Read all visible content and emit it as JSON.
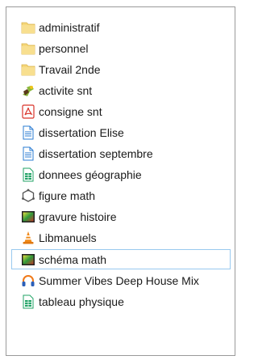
{
  "files": [
    {
      "name": "administratif",
      "icon": "folder-icon",
      "selected": false
    },
    {
      "name": "personnel",
      "icon": "folder-icon",
      "selected": false
    },
    {
      "name": "Travail 2nde",
      "icon": "folder-icon",
      "selected": false
    },
    {
      "name": "activite snt",
      "icon": "application-icon",
      "selected": false
    },
    {
      "name": "consigne snt",
      "icon": "pdf-icon",
      "selected": false
    },
    {
      "name": "dissertation Elise",
      "icon": "document-icon",
      "selected": false
    },
    {
      "name": "dissertation septembre",
      "icon": "document-icon",
      "selected": false
    },
    {
      "name": "donnees géographie",
      "icon": "spreadsheet-icon",
      "selected": false
    },
    {
      "name": "figure math",
      "icon": "geometry-icon",
      "selected": false
    },
    {
      "name": "gravure histoire",
      "icon": "image-icon",
      "selected": false
    },
    {
      "name": "Libmanuels",
      "icon": "vlc-cone-icon",
      "selected": false
    },
    {
      "name": "schéma math",
      "icon": "image-icon",
      "selected": true
    },
    {
      "name": "Summer Vibes Deep House Mix",
      "icon": "audio-headphones-icon",
      "selected": false
    },
    {
      "name": "tableau physique",
      "icon": "spreadsheet-icon",
      "selected": false
    }
  ],
  "colors": {
    "folder": "#f5d77a",
    "selection_border": "#99c9ef",
    "pdf": "#d9342b",
    "spreadsheet": "#21a366",
    "document": "#2b7cd3"
  }
}
